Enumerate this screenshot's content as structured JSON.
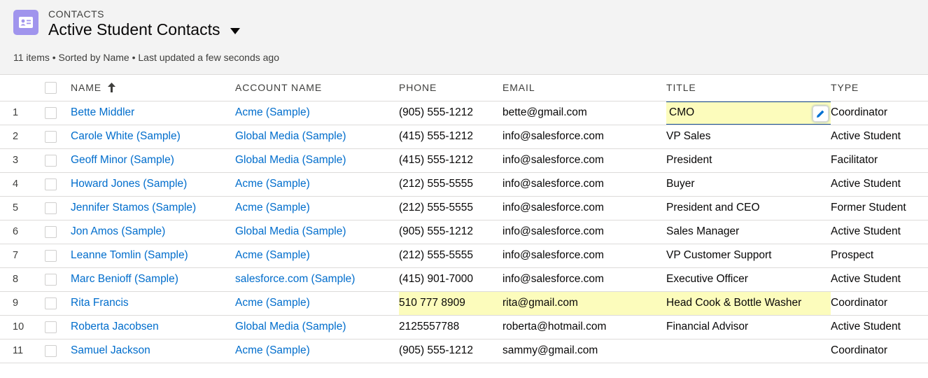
{
  "header": {
    "object_label": "CONTACTS",
    "icon": "contact-card-icon",
    "accent_color": "#a094ed",
    "title": "Active Student Contacts",
    "meta": "11 items • Sorted by Name • Last updated a few seconds ago"
  },
  "columns": {
    "name": "NAME",
    "account": "ACCOUNT NAME",
    "phone": "PHONE",
    "email": "EMAIL",
    "title": "TITLE",
    "type": "TYPE"
  },
  "rows": [
    {
      "num": "1",
      "name": "Bette Middler",
      "account": "Acme (Sample)",
      "phone": "(905) 555-1212",
      "email": "bette@gmail.com",
      "title": "CMO",
      "type": "Coordinator"
    },
    {
      "num": "2",
      "name": "Carole White (Sample)",
      "account": "Global Media (Sample)",
      "phone": "(415) 555-1212",
      "email": "info@salesforce.com",
      "title": "VP Sales",
      "type": "Active Student"
    },
    {
      "num": "3",
      "name": "Geoff Minor (Sample)",
      "account": "Global Media (Sample)",
      "phone": "(415) 555-1212",
      "email": "info@salesforce.com",
      "title": "President",
      "type": "Facilitator"
    },
    {
      "num": "4",
      "name": "Howard Jones (Sample)",
      "account": "Acme (Sample)",
      "phone": "(212) 555-5555",
      "email": "info@salesforce.com",
      "title": "Buyer",
      "type": "Active Student"
    },
    {
      "num": "5",
      "name": "Jennifer Stamos (Sample)",
      "account": "Acme (Sample)",
      "phone": "(212) 555-5555",
      "email": "info@salesforce.com",
      "title": "President and CEO",
      "type": "Former Student"
    },
    {
      "num": "6",
      "name": "Jon Amos (Sample)",
      "account": "Global Media (Sample)",
      "phone": "(905) 555-1212",
      "email": "info@salesforce.com",
      "title": "Sales Manager",
      "type": "Active Student"
    },
    {
      "num": "7",
      "name": "Leanne Tomlin (Sample)",
      "account": "Acme (Sample)",
      "phone": "(212) 555-5555",
      "email": "info@salesforce.com",
      "title": "VP Customer Support",
      "type": "Prospect"
    },
    {
      "num": "8",
      "name": "Marc Benioff (Sample)",
      "account": "salesforce.com (Sample)",
      "phone": "(415) 901-7000",
      "email": "info@salesforce.com",
      "title": "Executive Officer",
      "type": "Active Student"
    },
    {
      "num": "9",
      "name": "Rita Francis",
      "account": "Acme (Sample)",
      "phone": "510 777 8909",
      "email": "rita@gmail.com",
      "title": "Head Cook & Bottle Washer",
      "type": "Coordinator"
    },
    {
      "num": "10",
      "name": "Roberta Jacobsen",
      "account": "Global Media (Sample)",
      "phone": "2125557788",
      "email": "roberta@hotmail.com",
      "title": "Financial Advisor",
      "type": "Active Student"
    },
    {
      "num": "11",
      "name": "Samuel Jackson",
      "account": "Acme (Sample)",
      "phone": "(905) 555-1212",
      "email": "sammy@gmail.com",
      "title": "",
      "type": "Coordinator"
    }
  ]
}
